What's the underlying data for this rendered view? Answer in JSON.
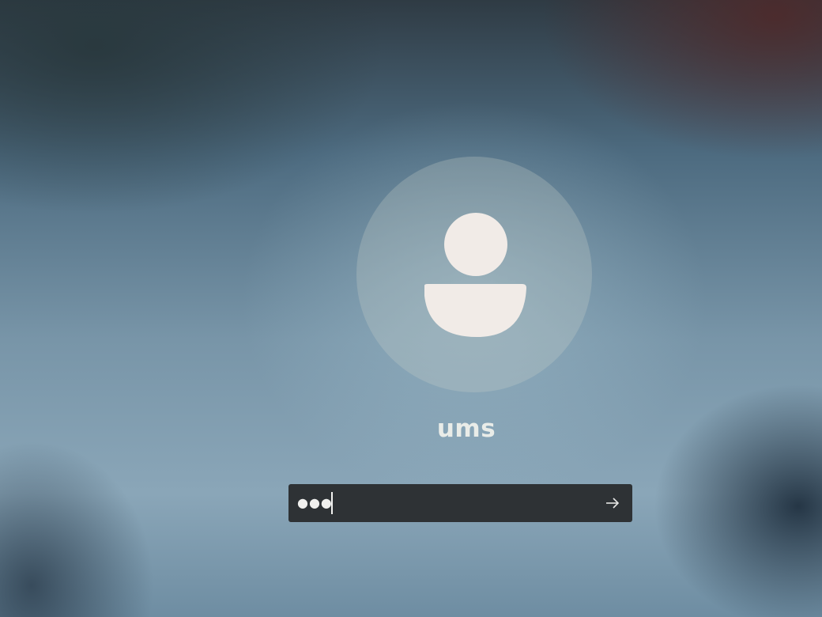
{
  "user": {
    "name": "ums",
    "avatar_icon": "user-silhouette-icon"
  },
  "password_field": {
    "masked_value": "●●●"
  },
  "submit": {
    "icon": "arrow-right-icon"
  },
  "colors": {
    "field_background": "#2e3235",
    "text": "#e9ece8",
    "avatar_figure": "#f1ebe7"
  }
}
